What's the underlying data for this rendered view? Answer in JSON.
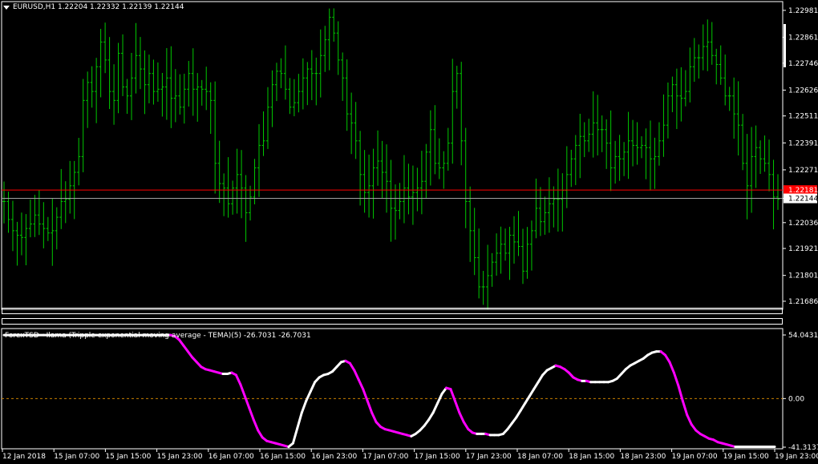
{
  "header": {
    "symbol_line": "EURUSD,H1  1.22204 1.22332 1.22139 1.22144"
  },
  "indicator": {
    "title": "ForexTSD - Ilama (Tripple exponential moving average - TEMA)(5) -26.7031 -26.7031"
  },
  "colors": {
    "background": "#000000",
    "bars": "#00c800",
    "grid_frame": "#ffffff",
    "bid_line": "#a0a0a0",
    "ask_line": "#ff0000",
    "indicator_up": "#ffffff",
    "indicator_down": "#ff00ff",
    "zero_level": "#c88000"
  },
  "chart_data": [
    {
      "type": "ohlc-bars",
      "symbol": "EURUSD",
      "timeframe": "H1",
      "current_price": "1.22144",
      "ask_price": "1.22181",
      "ylim": [
        1.2165,
        1.2302
      ],
      "y_ticks": [
        "1.22981",
        "1.22861",
        "1.22746",
        "1.22626",
        "1.22511",
        "1.22391",
        "1.22271",
        "1.22144",
        "1.22036",
        "1.21921",
        "1.21801",
        "1.21686"
      ],
      "close_series": [
        1.2213,
        1.2205,
        1.22,
        1.2198,
        1.2197,
        1.2201,
        1.2203,
        1.2207,
        1.2203,
        1.2201,
        1.2199,
        1.22,
        1.2206,
        1.2213,
        1.2214,
        1.222,
        1.2226,
        1.2233,
        1.2258,
        1.2266,
        1.2262,
        1.2273,
        1.2284,
        1.2276,
        1.2262,
        1.2258,
        1.2279,
        1.2264,
        1.226,
        1.2268,
        1.2278,
        1.2272,
        1.2265,
        1.227,
        1.2262,
        1.2263,
        1.2264,
        1.2268,
        1.2259,
        1.226,
        1.2255,
        1.2263,
        1.227,
        1.2263,
        1.2264,
        1.2263,
        1.2262,
        1.2258,
        1.223,
        1.2221,
        1.2219,
        1.2212,
        1.2219,
        1.2225,
        1.2219,
        1.2208,
        1.2215,
        1.2228,
        1.2238,
        1.224,
        1.2255,
        1.2265,
        1.2271,
        1.227,
        1.2263,
        1.2255,
        1.2257,
        1.2262,
        1.2268,
        1.2272,
        1.227,
        1.227,
        1.2278,
        1.2285,
        1.2295,
        1.2288,
        1.2276,
        1.2268,
        1.2252,
        1.2248,
        1.224,
        1.2225,
        1.2217,
        1.222,
        1.2228,
        1.2231,
        1.2226,
        1.2222,
        1.221,
        1.2209,
        1.2213,
        1.2219,
        1.2215,
        1.2217,
        1.2219,
        1.2222,
        1.2235,
        1.2245,
        1.223,
        1.2228,
        1.223,
        1.2239,
        1.2262,
        1.227,
        1.224,
        1.2213,
        1.22,
        1.2188,
        1.2175,
        1.2175,
        1.218,
        1.2186,
        1.219,
        1.2194,
        1.219,
        1.2198,
        1.2195,
        1.2193,
        1.2182,
        1.2194,
        1.22,
        1.221,
        1.2204,
        1.2208,
        1.2212,
        1.2214,
        1.2214,
        1.2218,
        1.2225,
        1.2232,
        1.2238,
        1.2242,
        1.224,
        1.2243,
        1.2248,
        1.2245,
        1.2245,
        1.2239,
        1.2228,
        1.2233,
        1.2232,
        1.2235,
        1.224,
        1.2238,
        1.2237,
        1.2238,
        1.2237,
        1.2232,
        1.2233,
        1.224,
        1.2247,
        1.226,
        1.2265,
        1.226,
        1.2259,
        1.2262,
        1.2273,
        1.2277,
        1.2277,
        1.2282,
        1.2284,
        1.2278,
        1.2274,
        1.2268,
        1.226,
        1.226,
        1.2252,
        1.2247,
        1.223,
        1.222,
        1.2233,
        1.2237,
        1.2232,
        1.223,
        1.2225,
        1.2215,
        1.2214
      ]
    },
    {
      "type": "line",
      "name": "ForexTSD - Ilama (Tripple exponential moving average - TEMA)(5)",
      "ylim": [
        -41.3137,
        54.0431
      ],
      "y_ticks": [
        "54.0431",
        "0.00",
        "-41.3137"
      ],
      "x_tick_labels": [
        "12 Jan 2018",
        "15 Jan 07:00",
        "15 Jan 15:00",
        "15 Jan 23:00",
        "16 Jan 07:00",
        "16 Jan 15:00",
        "16 Jan 23:00",
        "17 Jan 07:00",
        "17 Jan 15:00",
        "17 Jan 23:00",
        "18 Jan 07:00",
        "18 Jan 15:00",
        "18 Jan 23:00",
        "19 Jan 07:00",
        "19 Jan 15:00",
        "19 Jan 23:00"
      ],
      "values": [
        54,
        54,
        54,
        54,
        54,
        54,
        54,
        54,
        54,
        54,
        54,
        54,
        54,
        54,
        54,
        54,
        54,
        54,
        54,
        54,
        54,
        54,
        54,
        54,
        54,
        54,
        54,
        54,
        54,
        54,
        54,
        54,
        54,
        54,
        54,
        54,
        54,
        54,
        54,
        53,
        50,
        45,
        40,
        35,
        31,
        27,
        25,
        24,
        23,
        22,
        21,
        21,
        22,
        20,
        12,
        2,
        -8,
        -18,
        -27,
        -33,
        -36,
        -37,
        -38,
        -39,
        -40,
        -41,
        -38,
        -25,
        -12,
        -2,
        6,
        14,
        18,
        20,
        21,
        23,
        27,
        31,
        32,
        30,
        24,
        16,
        8,
        -2,
        -12,
        -20,
        -24,
        -26,
        -27,
        -28,
        -29,
        -30,
        -31,
        -32,
        -30,
        -27,
        -23,
        -18,
        -12,
        -4,
        4,
        9,
        8,
        -2,
        -12,
        -20,
        -26,
        -29,
        -30,
        -30,
        -30,
        -31,
        -31,
        -31,
        -30,
        -26,
        -21,
        -16,
        -10,
        -4,
        2,
        8,
        14,
        20,
        24,
        26,
        28,
        27,
        25,
        22,
        18,
        16,
        15,
        15,
        14,
        14,
        14,
        14,
        14,
        15,
        17,
        21,
        25,
        28,
        30,
        32,
        34,
        37,
        39,
        40,
        40,
        37,
        31,
        22,
        11,
        -2,
        -14,
        -22,
        -27,
        -30,
        -32,
        -34,
        -35,
        -37,
        -38,
        -39,
        -40,
        -41,
        -41,
        -41,
        -41,
        -41,
        -41,
        -41,
        -41,
        -41,
        -41
      ]
    }
  ]
}
